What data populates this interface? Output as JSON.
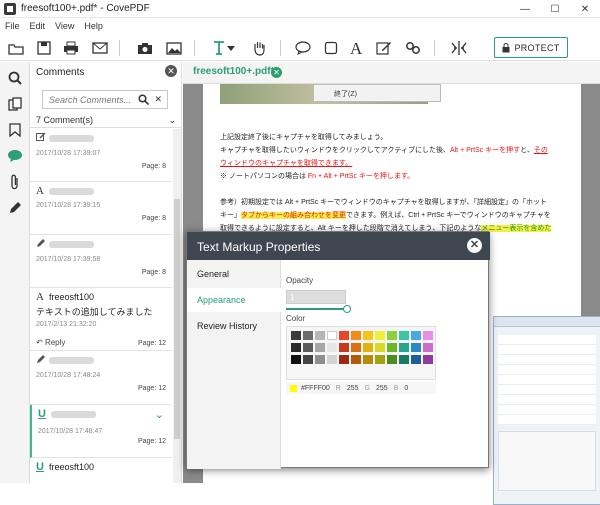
{
  "window": {
    "title": "freesoft100+.pdf* - CovePDF",
    "min": "—",
    "max": "☐",
    "close": "✕"
  },
  "menu": [
    "File",
    "Edit",
    "View",
    "Help"
  ],
  "toolbar": {
    "protect_label": "PROTECT"
  },
  "panel": {
    "title": "Comments",
    "search_placeholder": "Search Comments...",
    "count_label": "7 Comment(s)",
    "items": [
      {
        "date": "2017/10/28 17:39:07",
        "page": "Page: 8"
      },
      {
        "date": "2017/10/28 17:39:15",
        "page": "Page: 8"
      },
      {
        "date": "2017/10/28 17:39:58",
        "page": "Page: 8"
      },
      {
        "author": "freeosft100",
        "text": "テキストの追加してみました",
        "date": "2017/2/13 21:32:20",
        "reply": "Reply",
        "page": "Page: 12"
      },
      {
        "date": "2017/10/28 17:48:24",
        "page": "Page: 12"
      },
      {
        "date": "2017/10/28 17:48:47",
        "page": "Page: 12"
      },
      {
        "author": "freeosft100"
      }
    ]
  },
  "doc": {
    "tab": "freesoft100+.pdf*",
    "menu_item": "終了(Z)",
    "lines": {
      "l1": "上記設定終了後にキャプチャを取得してみましょう。",
      "l2a": "キャプチャを取得したいウィンドウをクリックしてアクティブにした後、",
      "l2b": "Alt + PrtSc キーを押す",
      "l2c": "と、",
      "l2d": "その",
      "l3": "ウィンドウのキャプチャを取得できます。",
      "l4a": "※ ノートパソコンの場合は ",
      "l4b": "Fn + Alt + PrtSc キーを押します。",
      "l5a": "参考）初期設定では Alt + PrtSc キーでウィンドウのキャプチャを取得しますが、「詳細設定」の「ホット",
      "l6a": "キー」",
      "l6b": "タブからキーの組み合わせを変更",
      "l6c": "できます。例えば、Ctrl + PrtSc キーでウィンドウのキャプチャを",
      "l7a": "取得できるように設定すると、Alt キーを押した段階で消えてしまう、下記のような",
      "l7b": "メニュー表示を含めた"
    }
  },
  "dialog": {
    "title": "Text Markup Properties",
    "tabs": [
      "General",
      "Appearance",
      "Review History"
    ],
    "opacity_label": "Opacity",
    "opacity_value": "1",
    "color_label": "Color",
    "hex": "#FFFF00",
    "r_label": "R",
    "r": "255",
    "g_label": "G",
    "g": "255",
    "b_label": "B",
    "b": "0",
    "palette": [
      "#3b3b3b",
      "#6b6b6b",
      "#b5b5b5",
      "#ffffff",
      "#e8462b",
      "#f28a1c",
      "#f5c51a",
      "#f0f03a",
      "#8dcf3f",
      "#3cc4a6",
      "#4ba8e8",
      "#e88fe8",
      "#2a2a2a",
      "#5a5a5a",
      "#a6a6a6",
      "#e6e6e6",
      "#c7381f",
      "#d8700f",
      "#e3b20f",
      "#d9d91f",
      "#6fb52a",
      "#28a58a",
      "#2c86c9",
      "#c86ec8",
      "#111111",
      "#444444",
      "#8f8f8f",
      "#d2d2d2",
      "#9e2915",
      "#b35a0a",
      "#b58d0a",
      "#a3a312",
      "#4f8c1c",
      "#1a7a66",
      "#1e5f9a",
      "#8e3a9e"
    ]
  },
  "colors": {
    "accent": "#2b9e73",
    "header": "#3e4650",
    "red_text": "#e11"
  }
}
